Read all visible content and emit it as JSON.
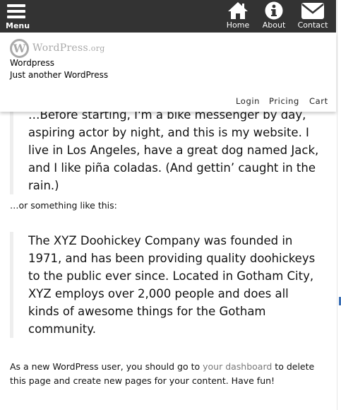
{
  "topbar": {
    "menu_label": "Menu",
    "nav": [
      {
        "label": "Home",
        "icon": "home-icon"
      },
      {
        "label": "About",
        "icon": "info-icon"
      },
      {
        "label": "Contact",
        "icon": "envelope-icon"
      }
    ]
  },
  "header": {
    "logo_mark": "W",
    "logo_text": "WordPress",
    "logo_suffix": ".org",
    "site_title": "Wordpress",
    "site_description": "Just another WordPress",
    "sub_nav": [
      "Login",
      "Pricing",
      "Cart"
    ]
  },
  "content": {
    "quote1": "…Before starting, I'm a bike messenger by day, aspiring actor by night, and this is my website. I live in Los Angeles, have a great dog named Jack, and I like piña coladas. (And gettin’ caught in the rain.)",
    "middle": "…or something like this:",
    "quote2": "The XYZ Doohickey Company was founded in 1971, and has been providing quality doohickeys to the public ever since. Located in Gotham City, XYZ employs over 2,000 people and does all kinds of awesome things for the Gotham community.",
    "bottom_before": "As a new WordPress user, you should go to ",
    "bottom_link": "your dashboard",
    "bottom_after": " to delete this page and create new pages for your content. Have fun!"
  },
  "colors": {
    "topbar_bg": "#333333",
    "link": "#7a7a7a",
    "logo_gray": "#aaaaaa"
  }
}
